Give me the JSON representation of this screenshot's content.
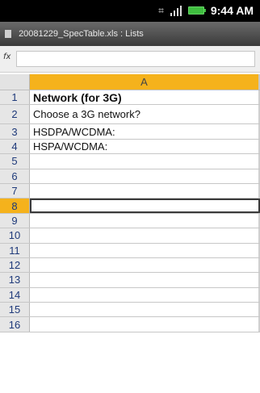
{
  "status_bar": {
    "time": "9:44 AM",
    "icons": [
      "usb-debug-icon",
      "signal-icon",
      "battery-icon"
    ],
    "battery_color": "#3fbe3f"
  },
  "title_bar": {
    "title": "20081229_SpecTable.xls : Lists"
  },
  "formula_bar": {
    "fx_label": "fx",
    "value": ""
  },
  "sheet": {
    "column_headers": [
      "A"
    ],
    "selected_row": 8,
    "rows": [
      {
        "num": "1",
        "a": "Network (for 3G)"
      },
      {
        "num": "2",
        "a": "Choose a 3G network?"
      },
      {
        "num": "3",
        "a": "HSDPA/WCDMA:"
      },
      {
        "num": "4",
        "a": "HSPA/WCDMA:"
      },
      {
        "num": "5",
        "a": ""
      },
      {
        "num": "6",
        "a": ""
      },
      {
        "num": "7",
        "a": ""
      },
      {
        "num": "8",
        "a": ""
      },
      {
        "num": "9",
        "a": ""
      },
      {
        "num": "10",
        "a": ""
      },
      {
        "num": "11",
        "a": ""
      },
      {
        "num": "12",
        "a": ""
      },
      {
        "num": "13",
        "a": ""
      },
      {
        "num": "14",
        "a": ""
      },
      {
        "num": "15",
        "a": ""
      },
      {
        "num": "16",
        "a": ""
      }
    ],
    "accent_color": "#f5b21c"
  }
}
